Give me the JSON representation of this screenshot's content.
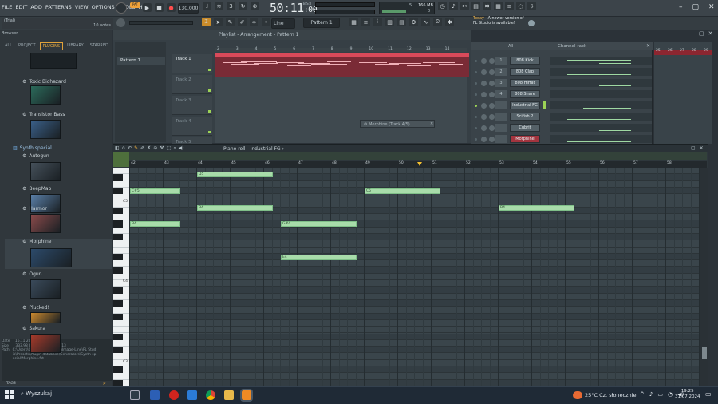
{
  "menu": [
    "FILE",
    "EDIT",
    "ADD",
    "PATTERNS",
    "VIEW",
    "OPTIONS",
    "TOOLS",
    "HELP"
  ],
  "transport": {
    "tempo": "130.000",
    "time_main": "50:11",
    "time_sub": ":00",
    "time_label": "B:S:T",
    "cpu_val": "5",
    "mem": "166 MB",
    "cpu_count": "0"
  },
  "hint": {
    "title": "(Trial)",
    "notes": "10 notes"
  },
  "pattern_selector": "Pattern 1",
  "snap": "Line",
  "news": {
    "date": "Today",
    "text": "A newer version of FL Studio is available!"
  },
  "browser": {
    "title": "Browser",
    "tabs": [
      "ALL",
      "PROJECT",
      "PLUGINS",
      "LIBRARY",
      "STARRED"
    ],
    "items": [
      "Toxic Biohazard",
      "Transistor Bass",
      "Synth special",
      "Autogun",
      "BeepMap",
      "Harmor",
      "Morphine",
      "Ogun",
      "Plucked!",
      "Sakura"
    ],
    "info": {
      "date_label": "Date",
      "date": "16.11.2022 08:47:34",
      "size_label": "Size",
      "size": "333.98 KB",
      "version": "Version 11.5.13",
      "path_label": "Path",
      "path": "C:\\Users\\Gargel\\Documents\\Image-Line\\FL Studio\\Presets\\Plugin database\\Generators\\Synth special\\Morphine.fst"
    },
    "tags": "TAGS"
  },
  "playlist": {
    "title": "Playlist - Arrangement",
    "pattern": "Pattern 1",
    "tracks": [
      "Track 1",
      "Track 2",
      "Track 3",
      "Track 4",
      "Track 5"
    ],
    "pattern_item": "Pattern 1",
    "bars": [
      "2",
      "3",
      "4",
      "5",
      "6",
      "7",
      "8",
      "9",
      "10",
      "11",
      "12",
      "13",
      "14"
    ]
  },
  "channel_rack": {
    "title": "Channel rack",
    "filter": "All",
    "channels": [
      {
        "num": "1",
        "name": "808 Kick"
      },
      {
        "num": "2",
        "name": "808 Clap"
      },
      {
        "num": "3",
        "name": "808 HiHat"
      },
      {
        "num": "4",
        "name": "808 Snare"
      },
      {
        "num": "",
        "name": "Industrial FG"
      },
      {
        "num": "",
        "name": "Scifish 2"
      },
      {
        "num": "",
        "name": "Cubrit"
      },
      {
        "num": "",
        "name": "Morphine"
      }
    ],
    "bars": [
      "25",
      "26",
      "27",
      "28",
      "29"
    ]
  },
  "float_window": {
    "title": "Morphine (Track 4/5)"
  },
  "piano_roll": {
    "title": "Piano roll",
    "instrument": "Industrial FG",
    "bars": [
      "42",
      "43",
      "44",
      "45",
      "46",
      "47",
      "48",
      "49",
      "50",
      "51",
      "52",
      "53",
      "54",
      "55",
      "56",
      "57",
      "58"
    ],
    "keys": [
      "C5",
      "C4",
      "C3"
    ],
    "notes": [
      {
        "label": "C#5",
        "bar": 0.0,
        "len": 1.5,
        "row": 0
      },
      {
        "label": "B4",
        "bar": 0.0,
        "len": 1.5,
        "row": 2
      },
      {
        "label": "D5",
        "bar": 2.0,
        "len": 2.25,
        "row": -1
      },
      {
        "label": "B4",
        "bar": 2.0,
        "len": 2.25,
        "row": 1
      },
      {
        "label": "G#4",
        "bar": 4.5,
        "len": 2.25,
        "row": 2
      },
      {
        "label": "E4",
        "bar": 4.5,
        "len": 2.25,
        "row": 4
      },
      {
        "label": "D#5",
        "bar": 7.0,
        "len": 2.25,
        "row": -2
      },
      {
        "label": "C5",
        "bar": 7.0,
        "len": 2.25,
        "row": 0
      },
      {
        "label": "B4",
        "bar": 11.0,
        "len": 2.25,
        "row": 1
      }
    ]
  },
  "taskbar": {
    "search": "Wyszukaj",
    "weather": "25°C  Cz. słonecznie",
    "time": "19:25",
    "date": "31.07.2024"
  }
}
